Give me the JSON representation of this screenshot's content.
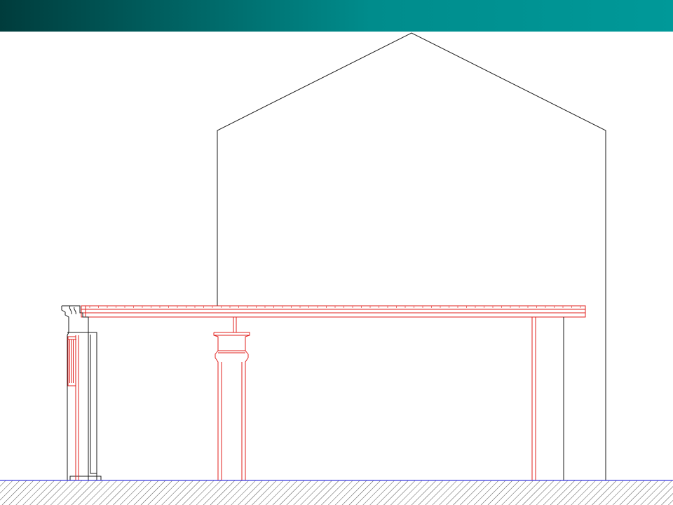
{
  "slide": {
    "header_gradient": [
      "#003c3c",
      "#008c8c",
      "#009999"
    ],
    "background": "#ffffff"
  },
  "drawing": {
    "type": "architectural-elevation",
    "colors": {
      "outline": "#1a1a1a",
      "structure": "#e0201e",
      "ground_line": "#3a3adf",
      "hatch": "#555555"
    }
  }
}
